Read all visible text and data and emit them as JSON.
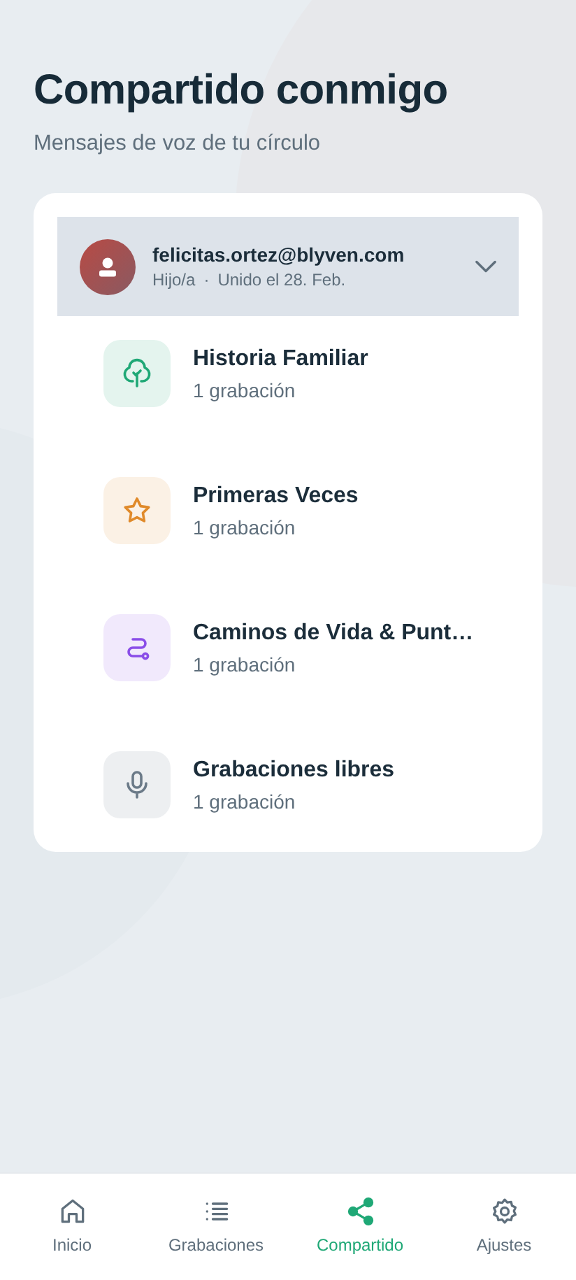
{
  "header": {
    "title": "Compartido conmigo",
    "subtitle": "Mensajes de voz de tu círculo"
  },
  "member": {
    "email": "felicitas.ortez@blyven.com",
    "relation": "Hijo/a",
    "separator": "·",
    "joined": "Unido el 28. Feb.",
    "expanded": true,
    "categories": [
      {
        "kind": "tree",
        "color": "#1fa876",
        "name": "Historia Familiar",
        "count": "1 grabación"
      },
      {
        "kind": "star",
        "color": "#e08a2a",
        "name": "Primeras Veces",
        "count": "1 grabación"
      },
      {
        "kind": "route",
        "color": "#8a4de8",
        "name": "Caminos de Vida & Punt…",
        "count": "1 grabación"
      },
      {
        "kind": "mic",
        "color": "#6b7a88",
        "name": "Grabaciones libres",
        "count": "1 grabación"
      }
    ]
  },
  "nav": [
    {
      "kind": "home",
      "label": "Inicio",
      "selected": false
    },
    {
      "kind": "list",
      "label": "Grabaciones",
      "selected": false
    },
    {
      "kind": "share",
      "label": "Compartido",
      "selected": true
    },
    {
      "kind": "gear",
      "label": "Ajustes",
      "selected": false
    }
  ]
}
